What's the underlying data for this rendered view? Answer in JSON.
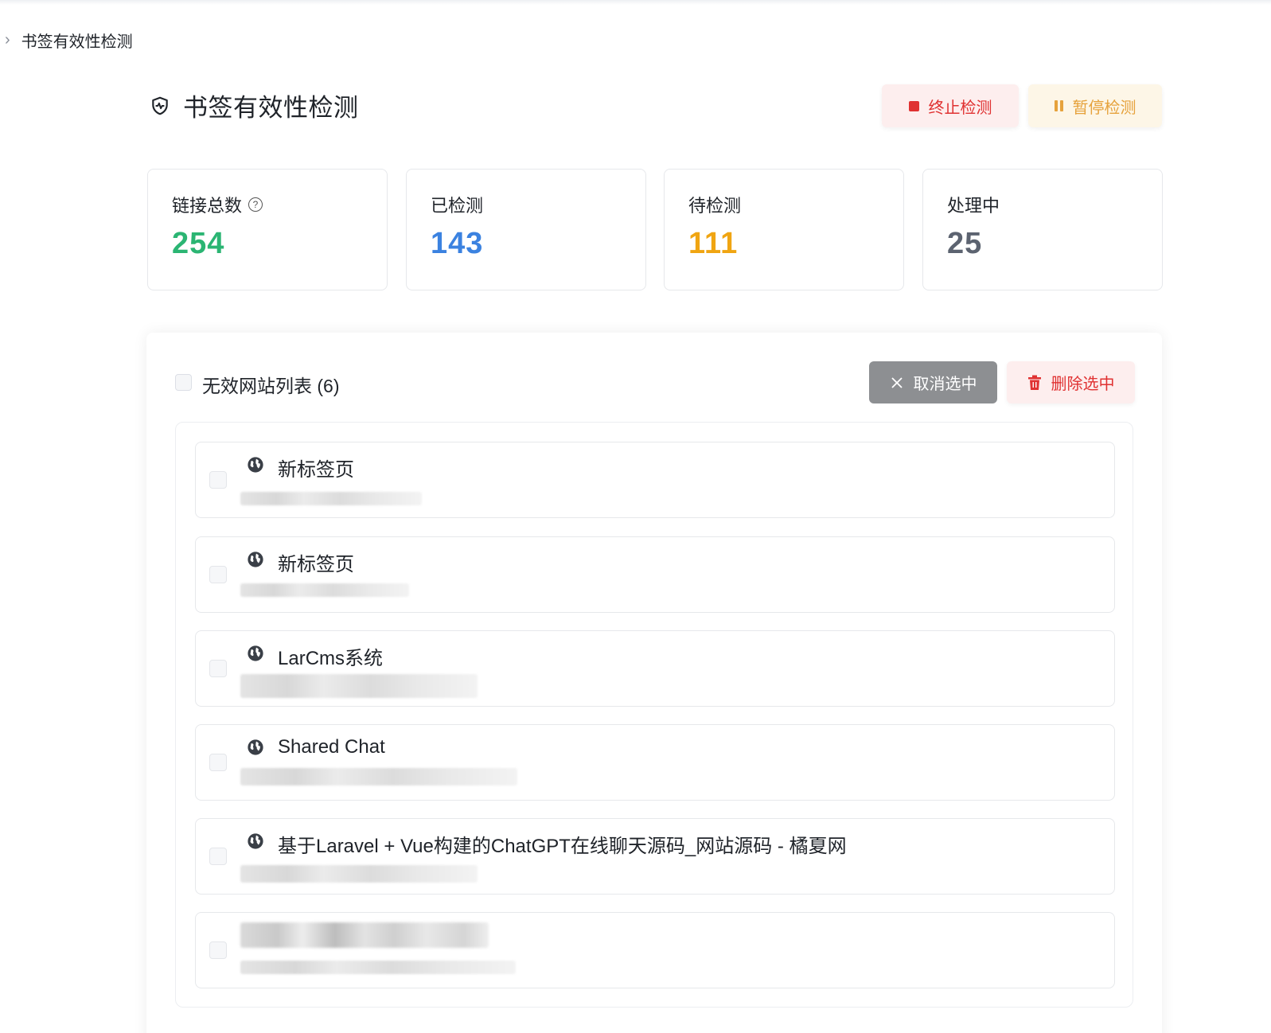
{
  "breadcrumb": {
    "current": "书签有效性检测"
  },
  "header": {
    "title": "书签有效性检测",
    "stop_label": "终止检测",
    "pause_label": "暂停检测"
  },
  "stats": [
    {
      "label": "链接总数",
      "value": "254",
      "color": "#2bb573",
      "has_help": true
    },
    {
      "label": "已检测",
      "value": "143",
      "color": "#3b82e0"
    },
    {
      "label": "待检测",
      "value": "111",
      "color": "#f0a512"
    },
    {
      "label": "处理中",
      "value": "25",
      "color": "#5c6370"
    }
  ],
  "panel": {
    "title": "无效网站列表 (6)",
    "cancel_label": "取消选中",
    "delete_label": "删除选中"
  },
  "items": [
    {
      "title": "新标签页",
      "icon": "globe-icon"
    },
    {
      "title": "新标签页",
      "icon": "globe-icon"
    },
    {
      "title": "LarCms系统",
      "icon": "globe-icon"
    },
    {
      "title": "Shared Chat",
      "icon": "globe-icon"
    },
    {
      "title": "基于Laravel + Vue构建的ChatGPT在线聊天源码_网站源码 - 橘夏网",
      "icon": "globe-icon"
    },
    {
      "title": "",
      "icon": ""
    }
  ],
  "colors": {
    "danger": "#e03131",
    "warning": "#e6a23c",
    "neutral_button": "#8d8f92"
  }
}
